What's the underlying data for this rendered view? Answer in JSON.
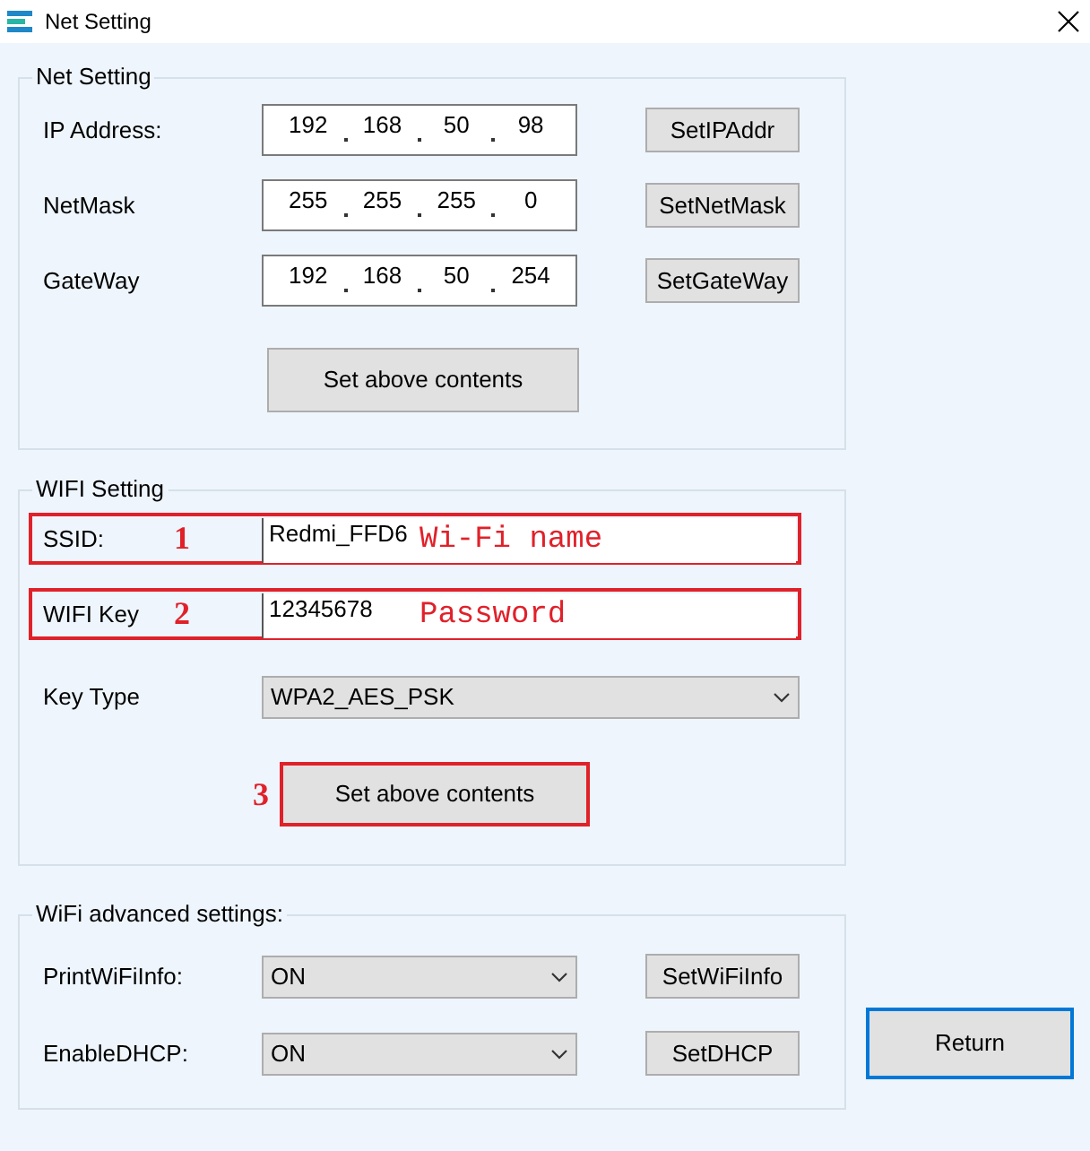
{
  "window": {
    "title": "Net Setting"
  },
  "net_setting": {
    "title": "Net Setting",
    "rows": [
      {
        "label": "IP Address:",
        "octets": [
          "192",
          "168",
          "50",
          "98"
        ],
        "button": "SetIPAddr"
      },
      {
        "label": "NetMask",
        "octets": [
          "255",
          "255",
          "255",
          "0"
        ],
        "button": "SetNetMask"
      },
      {
        "label": "GateWay",
        "octets": [
          "192",
          "168",
          "50",
          "254"
        ],
        "button": "SetGateWay"
      }
    ],
    "apply_button": "Set above contents"
  },
  "wifi_setting": {
    "title": "WIFI Setting",
    "fields": [
      {
        "kind": "text",
        "label": "SSID:",
        "value": "Redmi_FFD6",
        "highlighted": true,
        "marker": "1",
        "note": "Wi-Fi name"
      },
      {
        "kind": "text",
        "label": "WIFI Key",
        "value": "12345678",
        "highlighted": true,
        "marker": "2",
        "note": "Password"
      },
      {
        "kind": "select",
        "label": "Key Type",
        "value": "WPA2_AES_PSK",
        "highlighted": false
      }
    ],
    "apply_button": {
      "label": "Set above contents",
      "highlighted": true,
      "marker": "3"
    }
  },
  "advanced": {
    "title": "WiFi advanced settings:",
    "rows": [
      {
        "label": "PrintWiFiInfo:",
        "value": "ON",
        "button": "SetWiFiInfo"
      },
      {
        "label": "EnableDHCP:",
        "value": "ON",
        "button": "SetDHCP"
      }
    ]
  },
  "return_button": {
    "label": "Return",
    "focused": true
  }
}
